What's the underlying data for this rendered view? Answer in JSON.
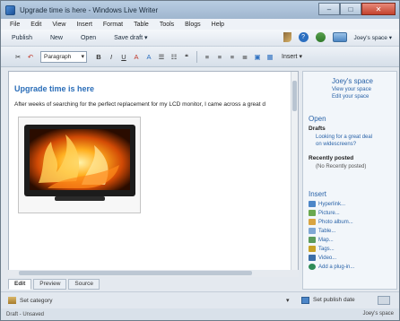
{
  "window": {
    "title": "Upgrade time is here - Windows Live Writer",
    "min_glyph": "–",
    "max_glyph": "□",
    "close_glyph": "✕"
  },
  "menu": [
    "File",
    "Edit",
    "View",
    "Insert",
    "Format",
    "Table",
    "Tools",
    "Blogs",
    "Help"
  ],
  "commands": {
    "publish": "Publish",
    "new": "New",
    "open": "Open",
    "save_draft": "Save draft ▾",
    "space_label": "Joey's space ▾"
  },
  "format_toolbar": {
    "style_value": "Paragraph",
    "bold": "B",
    "italic": "I",
    "underline": "U",
    "font_a": "A",
    "insert_label": "Insert ▾"
  },
  "editor": {
    "post_title": "Upgrade time is here",
    "post_body": "After weeks of searching for the perfect replacement for my LCD monitor, I came across a great d"
  },
  "tabs": [
    "Edit",
    "Preview",
    "Source"
  ],
  "sidebar": {
    "space_name": "Joey's space",
    "view_space": "View your space",
    "edit_space": "Edit your space",
    "open_title": "Open",
    "drafts_heading": "Drafts",
    "draft_item_line1": "Looking for a great deal",
    "draft_item_line2": "on widescreens?",
    "recent_heading": "Recently posted",
    "recent_empty": "(No Recently posted)",
    "insert_title": "Insert",
    "insert_items": [
      "Hyperlink...",
      "Picture...",
      "Photo album...",
      "Table...",
      "Map...",
      "Tags...",
      "Video...",
      "Add a plug-in..."
    ]
  },
  "bottom": {
    "category": "Set category",
    "publish_date": "Set publish date"
  },
  "status": {
    "left": "Draft - Unsaved",
    "right": "Joey's space"
  },
  "colors": {
    "accent_blue": "#2a63a8",
    "title_blue": "#2a6db8"
  }
}
